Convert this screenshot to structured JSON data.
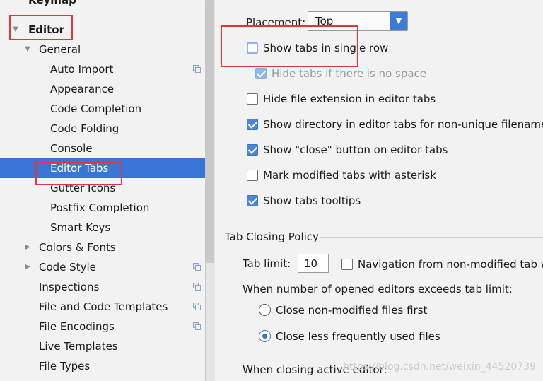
{
  "sidebar": {
    "items": [
      {
        "label": "Keymap"
      },
      {
        "label": "Editor"
      },
      {
        "label": "General"
      },
      {
        "label": "Auto Import"
      },
      {
        "label": "Appearance"
      },
      {
        "label": "Code Completion"
      },
      {
        "label": "Code Folding"
      },
      {
        "label": "Console"
      },
      {
        "label": "Editor Tabs"
      },
      {
        "label": "Gutter Icons"
      },
      {
        "label": "Postfix Completion"
      },
      {
        "label": "Smart Keys"
      },
      {
        "label": "Colors & Fonts"
      },
      {
        "label": "Code Style"
      },
      {
        "label": "Inspections"
      },
      {
        "label": "File and Code Templates"
      },
      {
        "label": "File Encodings"
      },
      {
        "label": "Live Templates"
      },
      {
        "label": "File Types"
      }
    ]
  },
  "main": {
    "placement_label": "Placement:",
    "placement_value": "Top",
    "options": [
      {
        "label": "Show tabs in single row",
        "checked": false
      },
      {
        "label": "Hide tabs if there is no space",
        "checked": true
      },
      {
        "label": "Hide file extension in editor tabs",
        "checked": false
      },
      {
        "label": "Show directory in editor tabs for non-unique filenames",
        "checked": true
      },
      {
        "label": "Show \"close\" button on editor tabs",
        "checked": true
      },
      {
        "label": "Mark modified tabs with asterisk",
        "checked": false
      },
      {
        "label": "Show tabs tooltips",
        "checked": true
      }
    ],
    "tab_closing_title": "Tab Closing Policy",
    "tab_limit_label": "Tab limit:",
    "tab_limit_value": "10",
    "navigation_label": "Navigation from non-modified tab w",
    "exceeds_label": "When number of opened editors exceeds tab limit:",
    "radio_options": [
      {
        "label": "Close non-modified files first",
        "selected": false
      },
      {
        "label": "Close less frequently used files",
        "selected": true
      }
    ],
    "closing_active_label": "When closing active editor:"
  },
  "watermark": "https://blog.csdn.net/weixin_44520739",
  "colors": {
    "selection": "#3875d7",
    "highlight_box": "#e0383a",
    "checkbox_checked": "#4a87d8"
  }
}
